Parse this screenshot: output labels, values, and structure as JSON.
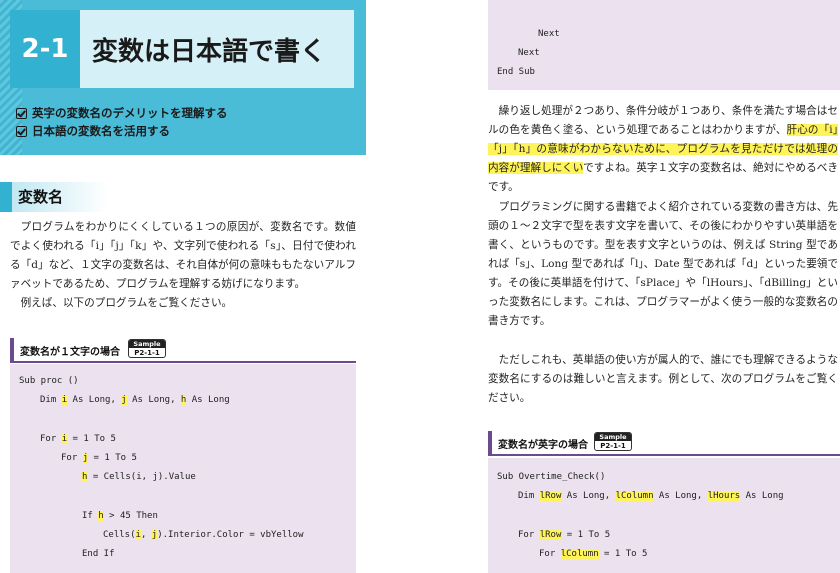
{
  "left": {
    "section_number": "2-1",
    "section_title": "変数は日本語で書く",
    "goals": [
      "英字の変数名のデメリットを理解する",
      "日本語の変数名を活用する"
    ],
    "heading": "変数名",
    "para1": "プログラムをわかりにくくしている１つの原因が、変数名です。数値でよく使われる「i」「j」「k」や、文字列で使われる「s」、日付で使われる「d」など、１文字の変数名は、それ自体が何の意味ももたないアルファベットであるため、プログラムを理解する妨げになります。",
    "para2": "例えば、以下のプログラムをご覧ください。",
    "code_label": "変数名が１文字の場合",
    "badge_top": "Sample",
    "badge_bottom": "P2-1-1",
    "code": {
      "l1": "Sub proc ()",
      "l2a": "Dim ",
      "l2v1": "i",
      "l2b": " As Long, ",
      "l2v2": "j",
      "l2c": " As Long, ",
      "l2v3": "h",
      "l2d": " As Long",
      "l3a": "For ",
      "l3v": "i",
      "l3b": " = 1 To 5",
      "l4a": "For ",
      "l4v": "j",
      "l4b": " = 1 To 5",
      "l5v": "h",
      "l5b": " = Cells(i, j).Value",
      "l6a": "If ",
      "l6v": "h",
      "l6b": " > 45 Then",
      "l7a": "Cells(",
      "l7v1": "i",
      "l7b": ", ",
      "l7v2": "j",
      "l7c": ").Interior.Color = vbYellow",
      "l8": "End If"
    }
  },
  "right": {
    "code_top": [
      "Next",
      "Next",
      "End Sub"
    ],
    "para1_a": "繰り返し処理が２つあり、条件分岐が１つあり、条件を満たす場合はセルの色を黄色く塗る、という処理であることはわかりますが、",
    "para1_hl": "肝心の「i」「j」「h」の意味がわからないために、プログラムを見ただけでは処理の内容が理解しにくい",
    "para1_b": "ですよね。英字１文字の変数名は、絶対にやめるべきです。",
    "para2": "プログラミングに関する書籍でよく紹介されている変数の書き方は、先頭の１〜２文字で型を表す文字を書いて、その後にわかりやすい英単語を書く、というものです。型を表す文字というのは、例えば String 型であれば「s」、Long 型であれば「l」、Date 型であれば「d」といった要領です。その後に英単語を付けて、「sPlace」や「lHours」、「dBilling」といった変数名にします。これは、プログラマーがよく使う一般的な変数名の書き方です。",
    "para3": "ただしこれも、英単語の使い方が属人的で、誰にでも理解できるような変数名にするのは難しいと言えます。例として、次のプログラムをご覧ください。",
    "code_label": "変数名が英字の場合",
    "badge_top": "Sample",
    "badge_bottom": "P2-1-1",
    "code": {
      "l1": "Sub Overtime_Check()",
      "l2a": "Dim ",
      "l2v1": "lRow",
      "l2b": " As Long, ",
      "l2v2": "lColumn",
      "l2c": " As Long, ",
      "l2v3": "lHours",
      "l2d": " As Long",
      "l3a": "For ",
      "l3v": "lRow",
      "l3b": " = 1 To 5",
      "l4a": "For ",
      "l4v": "lColumn",
      "l4b": " = 1 To 5"
    }
  },
  "colors": {
    "accent_blue": "#33b1d1",
    "highlight_yellow": "#fff35a",
    "code_bg": "#ebe1ef",
    "code_bar": "#6b4b8e"
  }
}
